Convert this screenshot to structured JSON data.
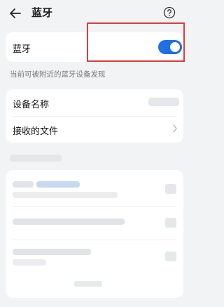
{
  "header": {
    "title": "蓝牙",
    "back_icon": "arrow-left-icon",
    "help_icon": "question-circle-icon"
  },
  "bluetooth": {
    "label": "蓝牙",
    "toggle_on": true,
    "toggle_color": "#1f6fe5"
  },
  "discoverable_note": "当前可被附近的蓝牙设备发现",
  "info_rows": [
    {
      "label": "设备名称"
    },
    {
      "label": "接收的文件"
    }
  ],
  "annotation": {
    "color": "#e23a3a"
  }
}
